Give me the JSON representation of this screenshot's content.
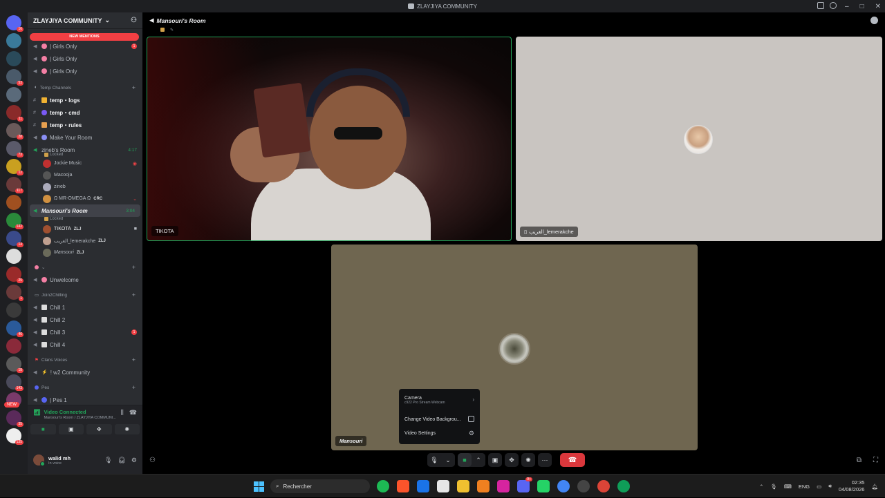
{
  "window": {
    "title": "ZLAYJIYA COMMUNITY"
  },
  "server_rail": {
    "badges": [
      "16",
      "",
      "",
      "53",
      "",
      "11",
      "28",
      "73",
      "12",
      "117",
      "",
      "142",
      "14",
      "",
      "25",
      "1",
      "",
      "46",
      "",
      "18",
      "143",
      "",
      "35",
      "135"
    ],
    "new_label": "NEW"
  },
  "sidebar": {
    "guild_name": "ZLAYJIYA COMMUNITY",
    "new_mentions": "NEW MENTIONS",
    "girls_channels": [
      "| Girls Only",
      "| Girls Only",
      "| Girls Only"
    ],
    "girls_badge": "1",
    "temp_category": "Temp Channels",
    "temp_channels": [
      "temp・logs",
      "temp・cmd",
      "temp・rules"
    ],
    "make_room": "Make Your Room",
    "zineb_room": {
      "name": "zineb's Room",
      "time": "4:17",
      "status": "Locked"
    },
    "zineb_users": [
      {
        "name": "Jockie Music",
        "tag": ""
      },
      {
        "name": "Macooja",
        "tag": ""
      },
      {
        "name": "zineb",
        "tag": ""
      },
      {
        "name": "Ω MR-OMEGA Ω",
        "tag": "CRC"
      }
    ],
    "mansouri_room": {
      "name": "Mansouri's Room",
      "time": "3:04",
      "status": "Locked"
    },
    "mansouri_users": [
      {
        "name": "TIKOTA",
        "tag": "ZLJ"
      },
      {
        "name": "الغريب_lemerakche",
        "tag": "ZLJ"
      },
      {
        "name": "Mansouri",
        "tag": "ZLJ"
      }
    ],
    "unwelcome": "Unwelcome",
    "join_category": "Join2Chilling",
    "chill_channels": [
      "Chill 1",
      "Chill 2",
      "Chill 3",
      "Chill 4"
    ],
    "chill3_badge": "1",
    "clans_category": "Clans Voices",
    "w2_community": "! w2 Community",
    "pes_category": "Pes",
    "pes1": "| Pes 1"
  },
  "voice_panel": {
    "status": "Video Connected",
    "location": "Mansouri's Room / ZLAYJIYA COMMUNI..."
  },
  "user_panel": {
    "name": "walid mh",
    "status": "In voice"
  },
  "main": {
    "room_name": "Mansouri's Room",
    "tiles": {
      "tikota": "TIKOTA",
      "lemerakche": "الغريب_lemerakche",
      "mansouri": "Mansouri"
    }
  },
  "camera_menu": {
    "camera_label": "Camera",
    "camera_device": "c922 Pro Stream Webcam",
    "change_bg": "Change Video Backgrou...",
    "video_settings": "Video Settings"
  },
  "taskbar": {
    "search_placeholder": "Rechercher",
    "discord_badge": "9+",
    "lang": "ENG",
    "time": "02:35",
    "date": "04/08/2026"
  },
  "colors": {
    "accent_green": "#23a55a",
    "danger_red": "#da373c",
    "mention_red": "#f23f43"
  }
}
